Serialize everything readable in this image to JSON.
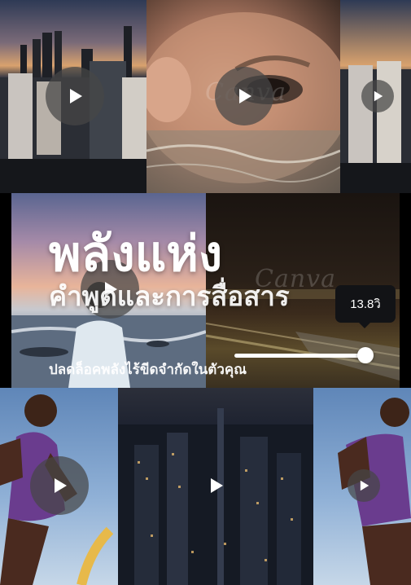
{
  "hero": {
    "title_line1": "พลังแห่ง",
    "title_line2": "คำพูดและการสื่อสาร",
    "subtitle": "ปลดล็อคพลังไร้ขีดจำกัดในตัวคุณ"
  },
  "slider": {
    "value_label": "13.8วิ",
    "progress": 1.0
  },
  "watermark": "Canva",
  "icons": {
    "play": "play-icon"
  },
  "colors": {
    "tooltip_bg": "#121316",
    "play_bg": "#464646",
    "slider": "#ffffff"
  }
}
